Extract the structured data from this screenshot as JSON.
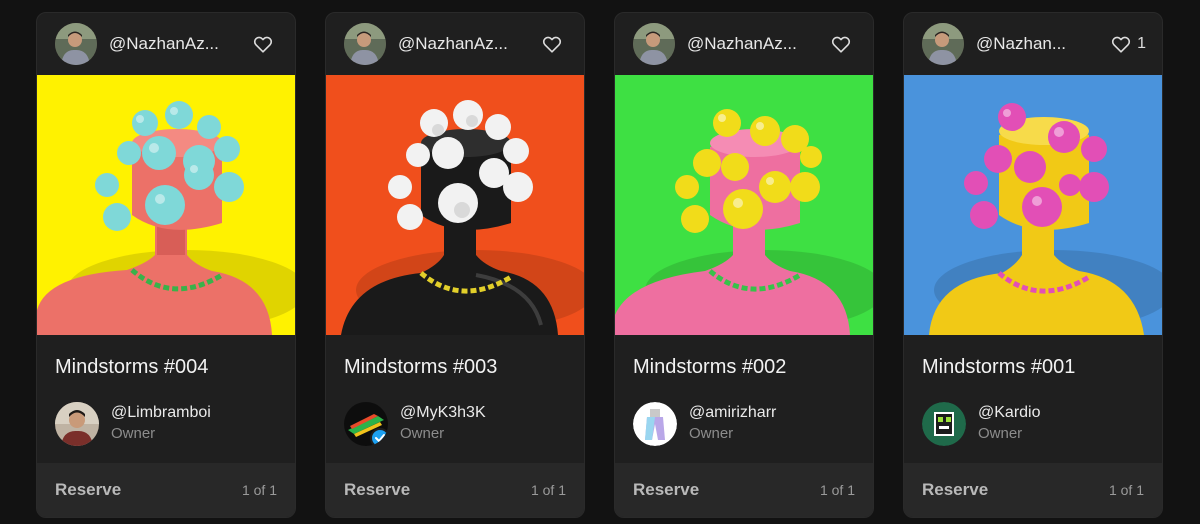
{
  "cards": [
    {
      "creator_handle": "@NazhanAz...",
      "like_count": "",
      "title": "Mindstorms #004",
      "owner_handle": "@Limbramboi",
      "owner_role": "Owner",
      "reserve_label": "Reserve",
      "edition": "1 of 1",
      "colors": {
        "background": "#fff200",
        "body": "#ec7168",
        "spheres": "#7fd8d8",
        "chain": "#39b24a"
      }
    },
    {
      "creator_handle": "@NazhanAz...",
      "like_count": "",
      "title": "Mindstorms #003",
      "owner_handle": "@MyK3h3K",
      "owner_role": "Owner",
      "reserve_label": "Reserve",
      "edition": "1 of 1",
      "colors": {
        "background": "#f04f1c",
        "body": "#1a1a1a",
        "spheres": "#f2f2f2",
        "chain": "#e2cf2a"
      }
    },
    {
      "creator_handle": "@NazhanAz...",
      "like_count": "",
      "title": "Mindstorms #002",
      "owner_handle": "@amirizharr",
      "owner_role": "Owner",
      "reserve_label": "Reserve",
      "edition": "1 of 1",
      "colors": {
        "background": "#3ee043",
        "body": "#ee6fa0",
        "spheres": "#f1dc1a",
        "chain": "#37c24a"
      }
    },
    {
      "creator_handle": "@Nazhan...",
      "like_count": "1",
      "title": "Mindstorms #001",
      "owner_handle": "@Kardio",
      "owner_role": "Owner",
      "reserve_label": "Reserve",
      "edition": "1 of 1",
      "colors": {
        "background": "#4a93dc",
        "body": "#f1c916",
        "spheres": "#e24fb6",
        "chain": "#e24fb6"
      }
    }
  ],
  "icons": {
    "like": "heart-outline-icon",
    "verified": "verified-badge-icon"
  }
}
